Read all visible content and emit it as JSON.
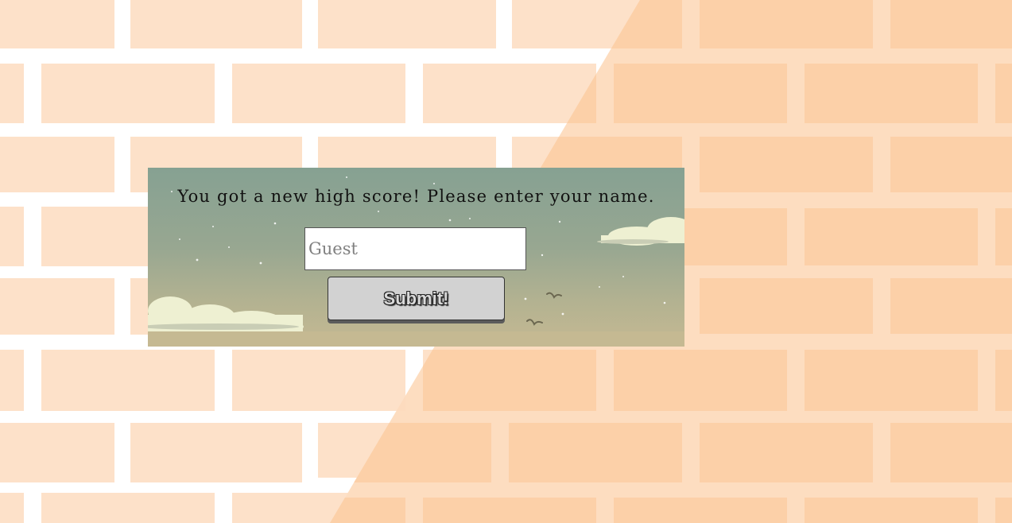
{
  "background": {
    "wall_color": "#fde3cb",
    "brick_color_light": "#fde1c9",
    "brick_color_shade": "#fcd0a8",
    "mortar_color": "#ffffff"
  },
  "dialog": {
    "prompt": "You got a new high score! Please enter your name.",
    "name_input": {
      "value": "",
      "placeholder": "Guest"
    },
    "submit_label": "Submit!",
    "sky_top_color": "#86a192",
    "sky_bottom_color": "#c5b992",
    "cloud_color": "#eef0d2"
  }
}
